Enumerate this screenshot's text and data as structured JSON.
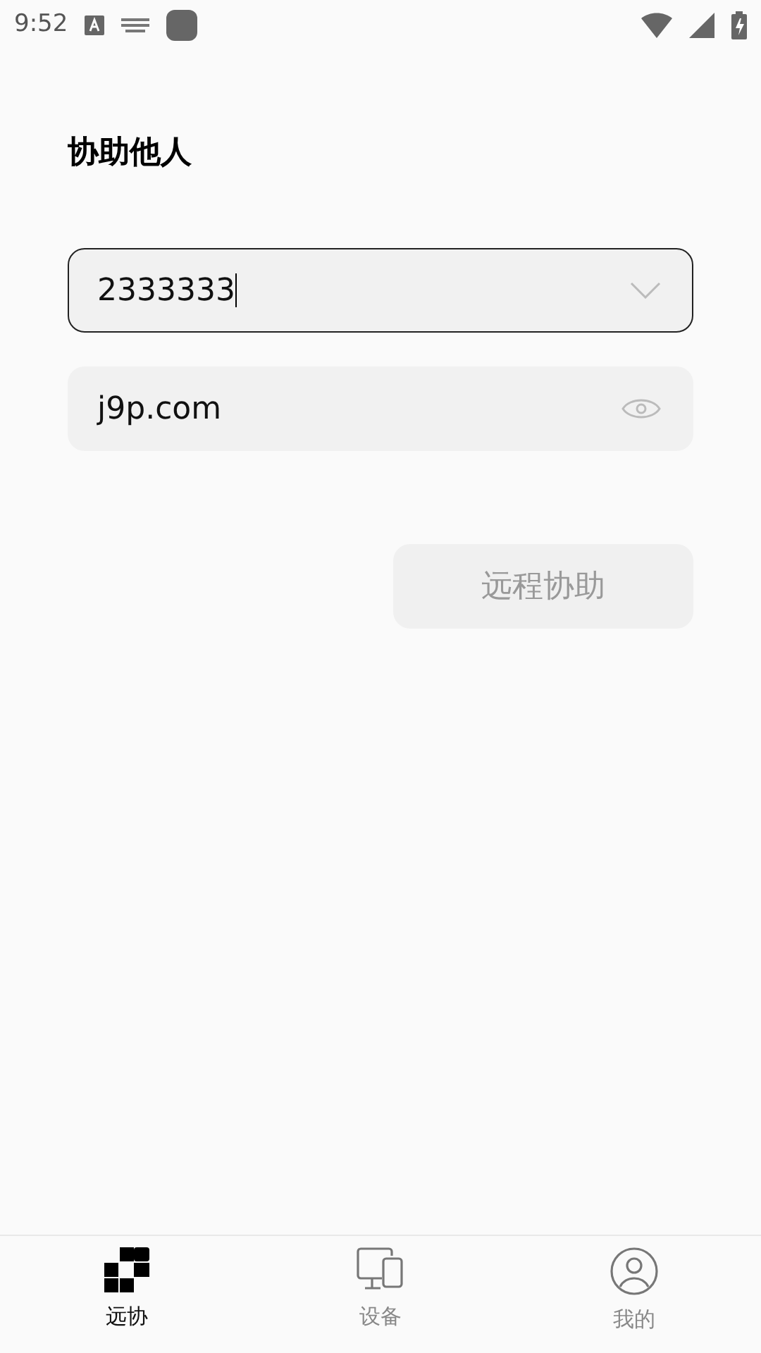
{
  "status_bar": {
    "time": "9:52"
  },
  "title": "协助他人",
  "fields": [
    {
      "kind": "dropdown",
      "value": "2333333",
      "focused": true
    },
    {
      "kind": "password",
      "value": "j9p.com",
      "focused": false
    }
  ],
  "action_button": {
    "label": "远程协助",
    "disabled": true
  },
  "tabs": [
    {
      "kind": "remote",
      "label": "远协",
      "selected": true
    },
    {
      "kind": "devices",
      "label": "设备",
      "selected": false
    },
    {
      "kind": "profile",
      "label": "我的",
      "selected": false
    }
  ]
}
